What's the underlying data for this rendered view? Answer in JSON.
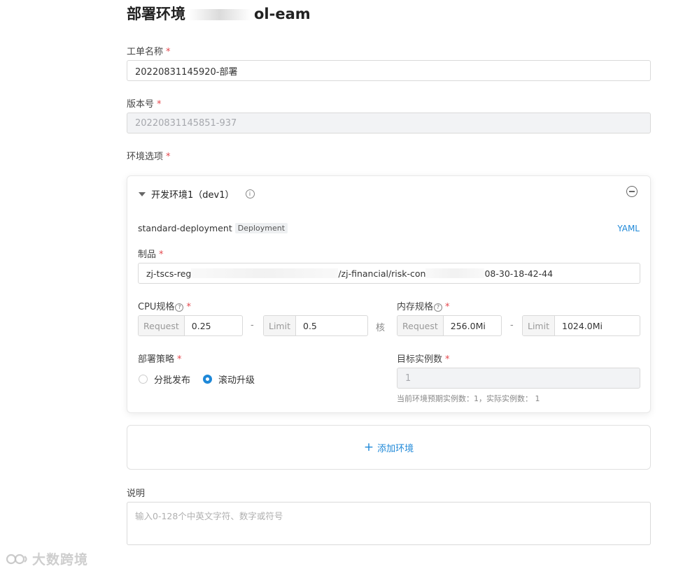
{
  "page": {
    "title_prefix": "部署环境",
    "title_suffix": "ol-eam"
  },
  "form": {
    "ticket_name": {
      "label": "工单名称",
      "value": "20220831145920-部署"
    },
    "version": {
      "label": "版本号",
      "value": "20220831145851-937"
    },
    "env_options": {
      "label": "环境选项"
    },
    "required_mark": "*"
  },
  "env_card": {
    "title": "开发环境1（dev1）",
    "deployment_name": "standard-deployment",
    "deployment_tag": "Deployment",
    "yaml_link": "YAML",
    "artifact": {
      "label": "制品",
      "value_part1": "zj-tscs-reg",
      "value_part2": "/zj-financial/risk-con",
      "value_part3": "08-30-18-42-44"
    },
    "cpu": {
      "label": "CPU规格",
      "request_label": "Request",
      "request_value": "0.25",
      "limit_label": "Limit",
      "limit_value": "0.5",
      "unit": "核",
      "dash": "-"
    },
    "memory": {
      "label": "内存规格",
      "request_label": "Request",
      "request_value": "256.0Mi",
      "limit_label": "Limit",
      "limit_value": "1024.0Mi",
      "dash": "-"
    },
    "strategy": {
      "label": "部署策略",
      "options": [
        "分批发布",
        "滚动升级"
      ],
      "selected": "滚动升级"
    },
    "replicas": {
      "label": "目标实例数",
      "value": "1",
      "hint": "当前环境预期实例数：1，实际实例数： 1"
    }
  },
  "add_env": {
    "label": "添加环境"
  },
  "description": {
    "label": "说明",
    "placeholder": "输入0-128个中英文字符、数字或符号"
  },
  "watermark": {
    "text": "大数跨境"
  },
  "colors": {
    "accent": "#1e88d8",
    "required": "#e5484d"
  }
}
